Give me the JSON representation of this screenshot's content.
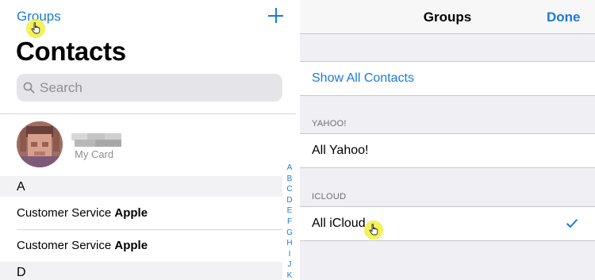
{
  "contacts_screen": {
    "groups_link": "Groups",
    "add_icon": "plus-icon",
    "title": "Contacts",
    "search_placeholder": "Search",
    "my_card_label": "My Card",
    "sections": [
      {
        "letter": "A",
        "rows": [
          {
            "first": "Customer Service",
            "last": "Apple"
          },
          {
            "first": "Customer Service",
            "last": "Apple"
          }
        ]
      },
      {
        "letter": "D",
        "rows": []
      }
    ],
    "index_letters": [
      "A",
      "B",
      "C",
      "D",
      "E",
      "F",
      "G",
      "H",
      "I",
      "J",
      "K"
    ]
  },
  "groups_screen": {
    "nav_title": "Groups",
    "done_label": "Done",
    "show_all_label": "Show All Contacts",
    "groups": [
      {
        "header": "YAHOO!",
        "item": "All Yahoo!",
        "checked": false
      },
      {
        "header": "ICLOUD",
        "item": "All iCloud",
        "checked": true
      }
    ]
  },
  "colors": {
    "accent": "#1b7ad6",
    "grouped_background": "#efeff4",
    "cursor_highlight": "#f0f03c"
  }
}
